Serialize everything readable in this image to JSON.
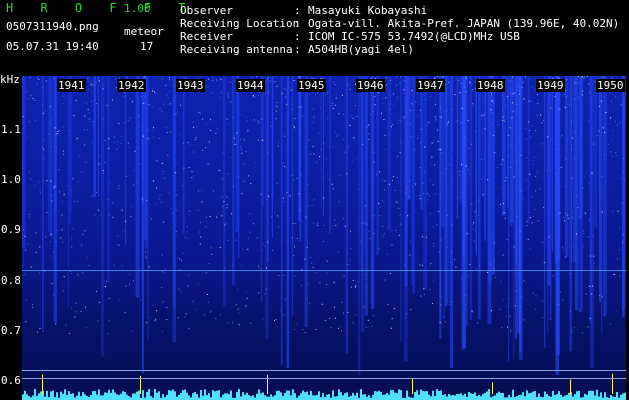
{
  "app": {
    "title": "H R O F F T",
    "version": "1.00"
  },
  "file": {
    "name": "0507311940.png",
    "datetime": "05.07.31 19:40"
  },
  "meteor": {
    "label": "meteor",
    "count": "17"
  },
  "info": [
    {
      "key": "Observer",
      "value": "Masayuki Kobayashi"
    },
    {
      "key": "Receiving Location",
      "value": "Ogata-vill. Akita-Pref. JAPAN (139.96E, 40.02N)"
    },
    {
      "key": "Receiver",
      "value": "ICOM IC-575 53.7492(@LCD)MHz USB"
    },
    {
      "key": "Receiving antenna",
      "value": "A504HB(yagi 4el)"
    }
  ],
  "spectrogram": {
    "y_unit": "kHz",
    "y_ticks": [
      "1.1",
      "1.0",
      "0.9",
      "0.8",
      "0.7",
      "0.6"
    ],
    "x_ticks": [
      "1941",
      "1942",
      "1943",
      "1944",
      "1945",
      "1946",
      "1947",
      "1948",
      "1949",
      "1950"
    ],
    "colors": {
      "background": "#0c1ea4",
      "bright": "#c8e6ff",
      "trace": "#4fe0ff",
      "meteor_mark": "#ffff40"
    }
  }
}
